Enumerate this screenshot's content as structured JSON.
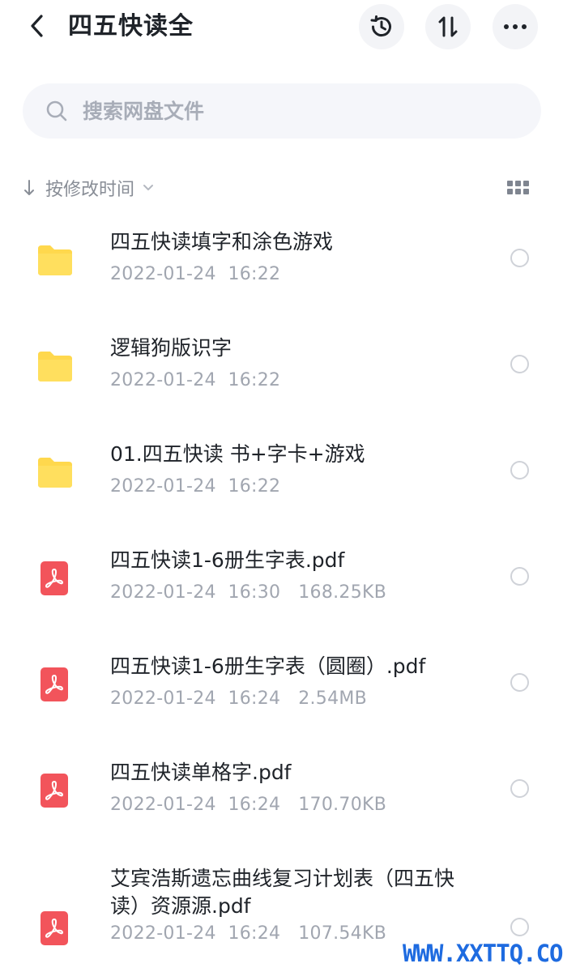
{
  "header": {
    "title": "四五快读全"
  },
  "search": {
    "placeholder": "搜索网盘文件"
  },
  "sort": {
    "label": "按修改时间"
  },
  "files": [
    {
      "type": "folder",
      "name": "四五快读填字和涂色游戏",
      "meta": "2022-01-24  16:22"
    },
    {
      "type": "folder",
      "name": "逻辑狗版识字",
      "meta": "2022-01-24  16:22"
    },
    {
      "type": "folder",
      "name": "01.四五快读 书+字卡+游戏",
      "meta": "2022-01-24  16:22"
    },
    {
      "type": "pdf",
      "name": "四五快读1-6册生字表.pdf",
      "meta": "2022-01-24  16:30   168.25KB"
    },
    {
      "type": "pdf",
      "name": "四五快读1-6册生字表（圆圈）.pdf",
      "meta": "2022-01-24  16:24   2.54MB"
    },
    {
      "type": "pdf",
      "name": "四五快读单格字.pdf",
      "meta": "2022-01-24  16:24   170.70KB"
    },
    {
      "type": "pdf",
      "name": "艾宾浩斯遗忘曲线复习计划表（四五快读）资源源.pdf",
      "meta": "2022-01-24  16:24   107.54KB"
    }
  ],
  "watermark": "WWW.XXTTQ.COM",
  "colors": {
    "folder": "#ffd84d",
    "pdf": "#f2545b",
    "watermark": "#1e6be0"
  }
}
